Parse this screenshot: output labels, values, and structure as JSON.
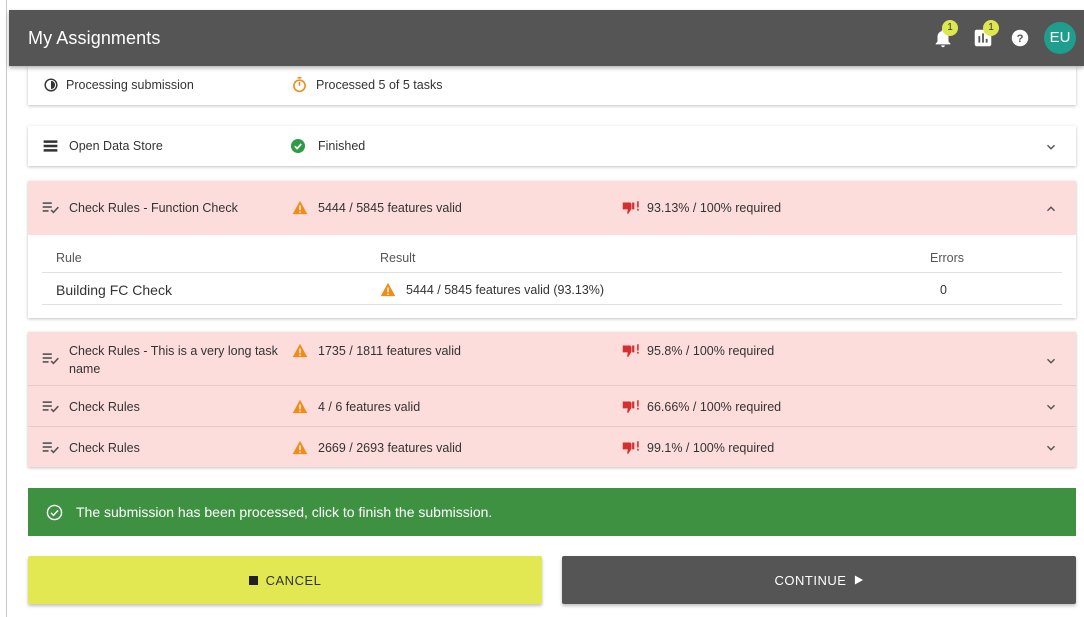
{
  "appbar": {
    "title": "My Assignments",
    "notifications_badge": "1",
    "reports_badge": "1",
    "avatar_initials": "EU",
    "colors": {
      "bar": "#555555",
      "badge": "#dde84e",
      "avatar": "#1f9e8e"
    }
  },
  "processing": {
    "label": "Processing submission",
    "status": "Processed 5 of 5 tasks",
    "icons": {
      "row": "half-circle-icon",
      "status": "stopwatch-icon"
    }
  },
  "data_store": {
    "label": "Open Data Store",
    "status": "Finished",
    "icons": {
      "row": "list-icon",
      "status": "check-circle-icon"
    }
  },
  "function_check": {
    "label": "Check Rules - Function Check",
    "status": "5444 / 5845 features valid",
    "score": "93.13% / 100% required",
    "table": {
      "headers": {
        "rule": "Rule",
        "result": "Result",
        "errors": "Errors"
      },
      "rows": [
        {
          "rule": "Building FC Check",
          "result": "5444 / 5845 features valid (93.13%)",
          "errors": "0"
        }
      ]
    }
  },
  "tasks": [
    {
      "label_line1": "Check Rules - This is a very long task",
      "label_line2": "name",
      "status": "1735 / 1811 features valid",
      "score": "95.8% / 100% required"
    },
    {
      "label_line1": "Check Rules",
      "label_line2": "",
      "status": "4 / 6 features valid",
      "score": "66.66% / 100% required"
    },
    {
      "label_line1": "Check Rules",
      "label_line2": "",
      "status": "2669 / 2693 features valid",
      "score": "99.1% / 100% required"
    }
  ],
  "banner": {
    "text": "The submission has been processed, click to finish the submission.",
    "color": "#3f9142"
  },
  "buttons": {
    "cancel": "CANCEL",
    "continue": "CONTINUE",
    "colors": {
      "cancel": "#e2e851",
      "continue": "#555555"
    }
  },
  "colors": {
    "failed_row": "#fddcdc",
    "warning": "#ef8c1a",
    "thumbs_down": "#d32f2f",
    "success": "#2e9b47"
  }
}
